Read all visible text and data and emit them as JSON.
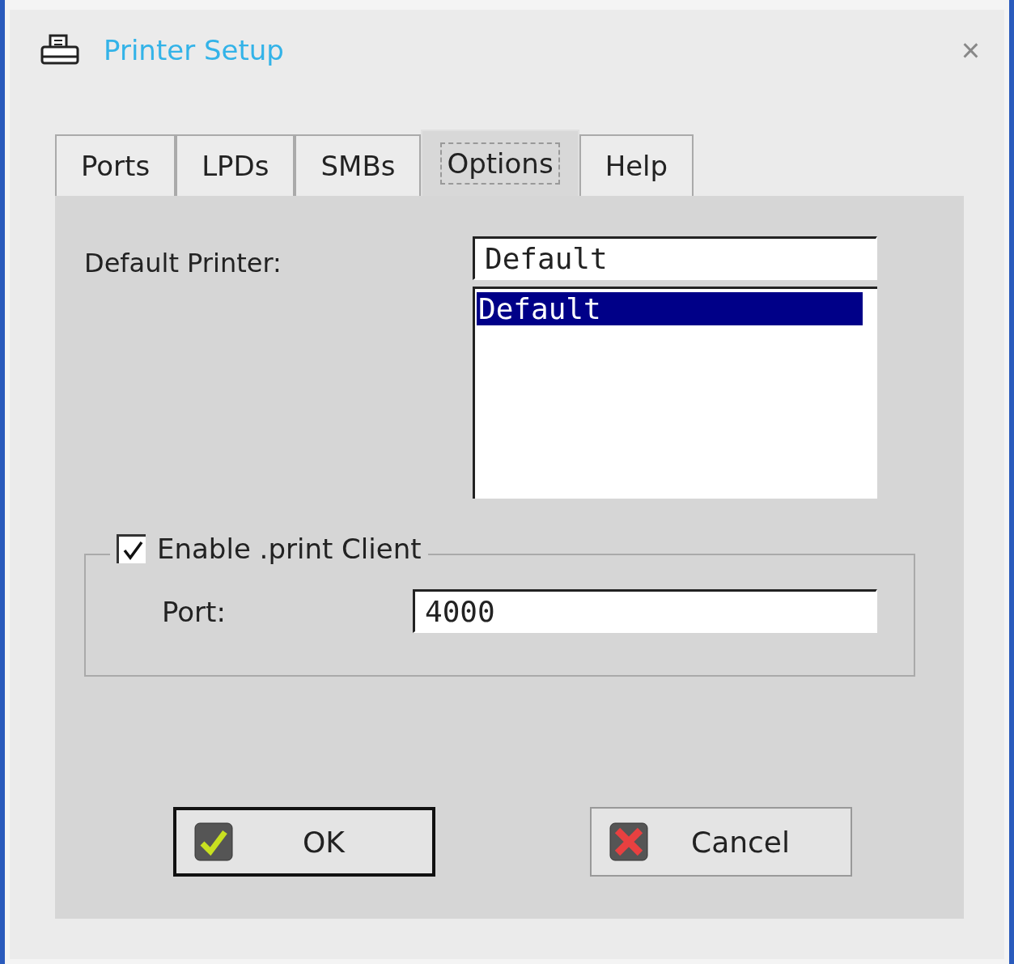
{
  "window": {
    "title": "Printer Setup",
    "close": "×"
  },
  "tabs": [
    {
      "label": "Ports",
      "selected": false
    },
    {
      "label": "LPDs",
      "selected": false
    },
    {
      "label": "SMBs",
      "selected": false
    },
    {
      "label": "Options",
      "selected": true
    },
    {
      "label": "Help",
      "selected": false
    }
  ],
  "default_printer": {
    "label": "Default Printer:",
    "value": "Default",
    "options": [
      {
        "label": "Default",
        "selected": true
      }
    ]
  },
  "print_client": {
    "label": "Enable .print Client",
    "checked": true,
    "port_label": "Port:",
    "port_value": "4000"
  },
  "buttons": [
    {
      "label": "OK",
      "kind": "ok",
      "default": true
    },
    {
      "label": "Cancel",
      "kind": "cancel",
      "default": false
    }
  ]
}
